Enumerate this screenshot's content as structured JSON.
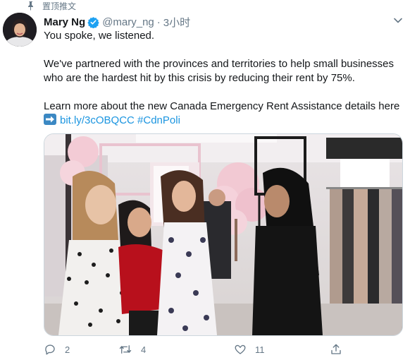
{
  "pinned": {
    "label": "置顶推文"
  },
  "tweet": {
    "display_name": "Mary Ng",
    "handle": "@mary_ng",
    "separator": "·",
    "time": "3小时",
    "line1": "You spoke, we listened.",
    "para2": "We've partnered with the provinces and territories to help small businesses who are the hardest hit by this crisis by reducing their rent by 75%.",
    "para3": "Learn more about the new Canada Emergency Rent Assistance details here",
    "link": "bit.ly/3cOBQCC",
    "hashtag": "#CdnPoli",
    "image_alt": "",
    "media_icon": "photo-of-five-women-talking-in-clothing-store"
  },
  "actions": {
    "reply_count": "2",
    "retweet_count": "4",
    "like_count": "11"
  },
  "colors": {
    "link": "#1b95e0",
    "muted": "#657786",
    "verified": "#1da1f2"
  }
}
